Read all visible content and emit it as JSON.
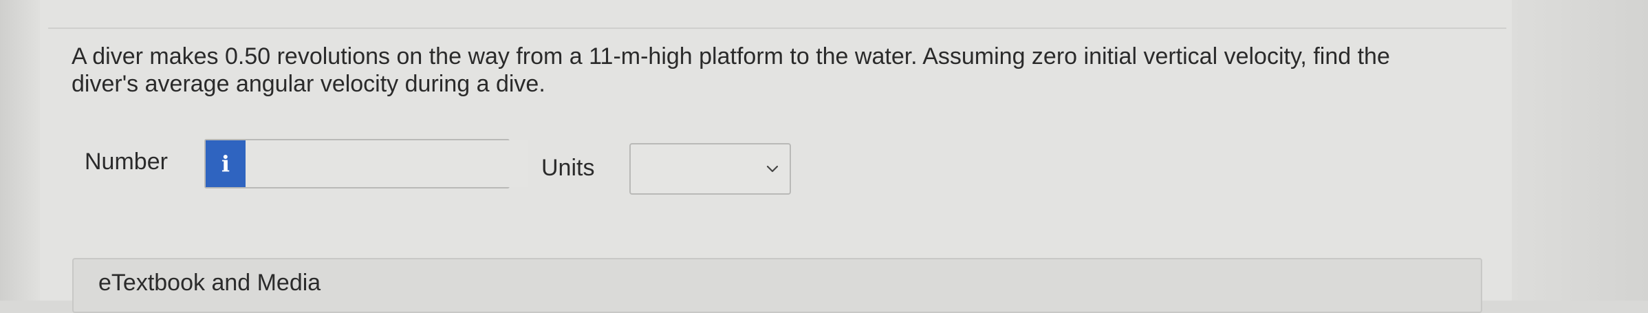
{
  "question": {
    "text": "A diver makes 0.50 revolutions on the way from a 11-m-high platform to the water. Assuming zero initial vertical velocity, find the diver's average angular velocity during a dive."
  },
  "answer": {
    "number_label": "Number",
    "info_icon": "info-icon",
    "info_glyph": "i",
    "number_value": "",
    "units_label": "Units",
    "units_selected": "",
    "units_icon": "chevron-down-icon"
  },
  "resources": {
    "etextbook_label": "eTextbook and Media"
  },
  "colors": {
    "info_button": "#2f64c0",
    "background": "#e3e3e1"
  }
}
